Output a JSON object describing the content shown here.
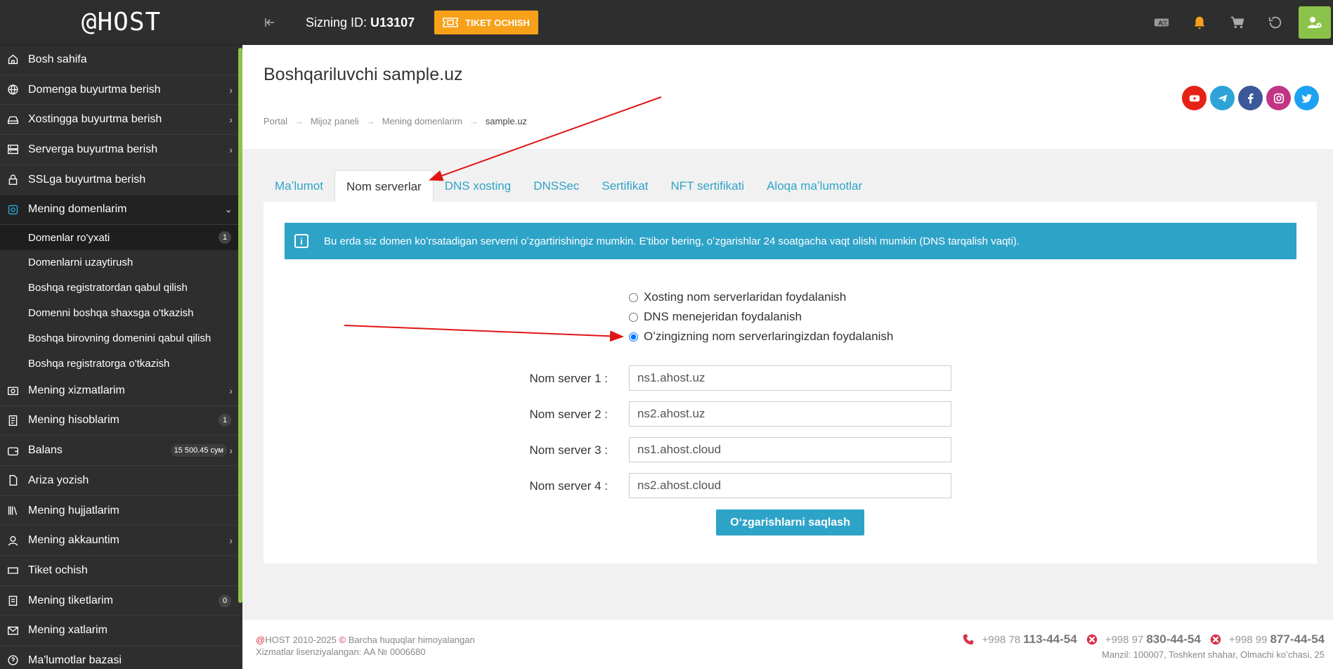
{
  "brand": {
    "logo": "@HOST"
  },
  "sidebar": {
    "items": [
      {
        "label": "Bosh sahifa",
        "icon": "home-icon"
      },
      {
        "label": "Domenga buyurtma berish",
        "icon": "globe-icon"
      },
      {
        "label": "Xostingga buyurtma berish",
        "icon": "hdd-icon"
      },
      {
        "label": "Serverga buyurtma berish",
        "icon": "server-icon"
      },
      {
        "label": "SSLga buyurtma berish",
        "icon": "lock-icon"
      },
      {
        "label": "Mening domenlarim",
        "icon": "domain-icon"
      }
    ],
    "sub_items": [
      {
        "label": "Domenlar ro'yxati",
        "badge": "1"
      },
      {
        "label": "Domenlarni uzaytirush"
      },
      {
        "label": "Boshqa registratordan qabul qilish"
      },
      {
        "label": "Domenni boshqa shaxsga o'tkazish"
      },
      {
        "label": "Boshqa birovning domenini qabul qilish"
      },
      {
        "label": "Boshqa registratorga o'tkazish"
      }
    ],
    "items2": [
      {
        "label": "Mening xizmatlarim",
        "icon": "services-icon"
      },
      {
        "label": "Mening hisoblarim",
        "icon": "invoice-icon",
        "badge": "1"
      },
      {
        "label": "Balans",
        "icon": "wallet-icon",
        "badge": "15 500.45 сум"
      },
      {
        "label": "Ariza yozish",
        "icon": "document-icon"
      },
      {
        "label": "Mening hujjatlarim",
        "icon": "books-icon"
      },
      {
        "label": "Mening akkauntim",
        "icon": "user-icon"
      },
      {
        "label": "Tiket ochish",
        "icon": "ticket-icon"
      },
      {
        "label": "Mening tiketlarim",
        "icon": "clipboard-icon",
        "badge": "0"
      },
      {
        "label": "Mening xatlarim",
        "icon": "mail-icon"
      },
      {
        "label": "Ma'lumotlar bazasi",
        "icon": "help-icon"
      }
    ]
  },
  "topbar": {
    "id_label": "Sizning ID: ",
    "id_value": "U13107",
    "ticket_button": "TIKET OCHISH"
  },
  "header": {
    "title": "Boshqariluvchi sample.uz",
    "breadcrumb": [
      "Portal",
      "Mijoz paneli",
      "Mening domenlarim",
      "sample.uz"
    ]
  },
  "tabs": [
    "Maʼlumot",
    "Nom serverlar",
    "DNS xosting",
    "DNSSec",
    "Sertifikat",
    "NFT sertifikati",
    "Aloqa maʼlumotlar"
  ],
  "active_tab": "Nom serverlar",
  "info_text": "Bu erda siz domen koʻrsatadigan serverni oʻzgartirishingiz mumkin. E'tibor bering, oʻzgarishlar 24 soatgacha vaqt olishi mumkin (DNS tarqalish vaqti).",
  "radio_options": [
    {
      "label": "Xosting nom serverlaridan foydalanish",
      "checked": false
    },
    {
      "label": "DNS menejeridan foydalanish",
      "checked": false
    },
    {
      "label": "Oʻzingizning nom serverlaringizdan foydalanish",
      "checked": true
    }
  ],
  "nameservers": [
    {
      "label": "Nom server 1 :",
      "value": "ns1.ahost.uz"
    },
    {
      "label": "Nom server 2 :",
      "value": "ns2.ahost.uz"
    },
    {
      "label": "Nom server 3 :",
      "value": "ns1.ahost.cloud"
    },
    {
      "label": "Nom server 4 :",
      "value": "ns2.ahost.cloud"
    }
  ],
  "save_button": "Oʻzgarishlarni saqlash",
  "footer": {
    "copyright_prefix": "@",
    "copyright": "HOST 2010-2025",
    "rights": "Barcha huquqlar himoyalangan",
    "license": "Xizmatlar lisenziyalangan: AA № 0006680",
    "phones": [
      {
        "prefix": "+998 78",
        "number": "113-44-54"
      },
      {
        "prefix": "+998 97",
        "number": "830-44-54"
      },
      {
        "prefix": "+998 99",
        "number": "877-44-54"
      }
    ],
    "address": "Manzil: 100007, Toshkent shahar, Olmachi koʻchasi, 25"
  },
  "colors": {
    "accent": "#2ea3c8",
    "orange": "#f7a11a",
    "green": "#8bc34a",
    "sidebar": "#2e2e2e"
  }
}
